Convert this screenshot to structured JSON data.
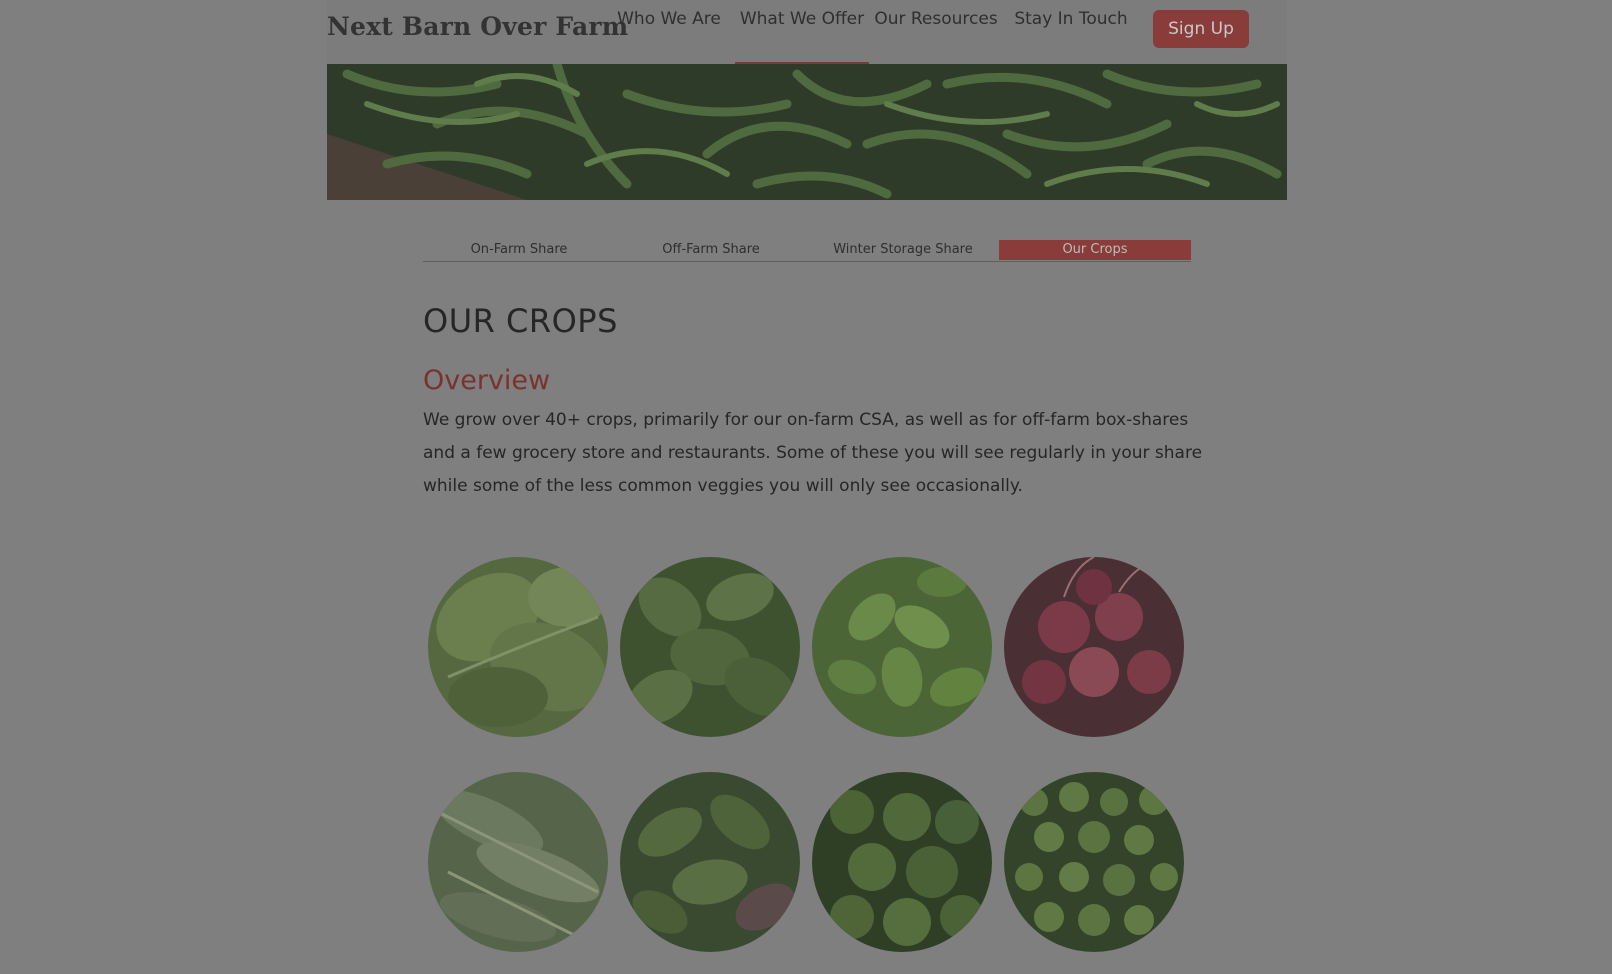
{
  "header": {
    "brand": "Next Barn Over Farm",
    "nav": [
      {
        "label": "Who We Are"
      },
      {
        "label": "What We Offer",
        "active": true
      },
      {
        "label": "Our Resources"
      },
      {
        "label": "Stay In Touch"
      }
    ],
    "signup_label": "Sign Up"
  },
  "subnav": {
    "tabs": [
      {
        "label": "On-Farm Share"
      },
      {
        "label": "Off-Farm Share"
      },
      {
        "label": "Winter Storage Share"
      },
      {
        "label": "Our Crops",
        "active": true
      }
    ]
  },
  "main": {
    "title": "OUR CROPS",
    "section_heading": "Overview",
    "intro": "We grow over 40+ crops, primarily for our on-farm CSA, as well as for off-farm box-shares and a few grocery store and restaurants. Some of these you will see regularly in your share while some of the less common veggies you will only see occasionally."
  },
  "colors": {
    "accent": "#8a3c3a",
    "heading_accent": "#7a3230",
    "overlay_background": "#7f7f7f"
  }
}
